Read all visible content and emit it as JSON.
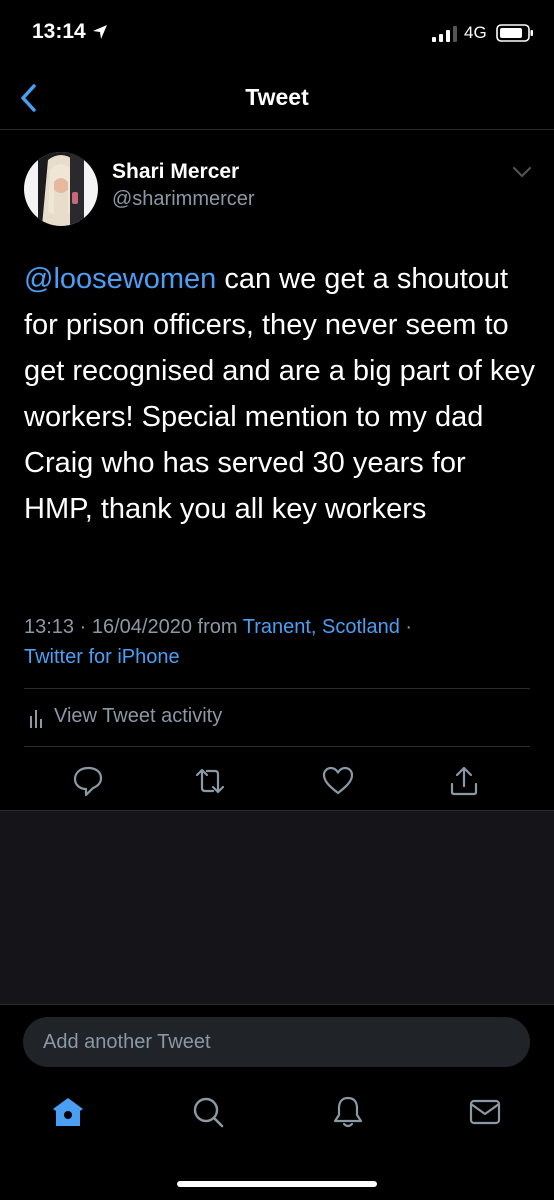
{
  "status_bar": {
    "time": "13:14",
    "network": "4G",
    "icons": [
      "location-arrow-icon",
      "signal-icon",
      "battery-icon"
    ]
  },
  "nav": {
    "title": "Tweet",
    "back_icon": "chevron-left-icon"
  },
  "tweet": {
    "author": {
      "display_name": "Shari Mercer",
      "handle": "@sharimmercer"
    },
    "mention": "@loosewomen",
    "text": " can we get a shoutout for prison officers, they never seem to get recognised and are a big part of key workers! Special mention to my dad Craig who has served 30 years for HMP, thank you all key workers",
    "meta": {
      "time": "13:13",
      "separator": " · ",
      "date": "16/04/2020",
      "from_label": " from ",
      "location": "Tranent, Scotland",
      "separator2": " · ",
      "source": "Twitter for iPhone"
    },
    "activity_label": "View Tweet activity",
    "actions": [
      "reply-icon",
      "retweet-icon",
      "like-icon",
      "share-icon"
    ]
  },
  "compose": {
    "placeholder": "Add another Tweet"
  },
  "tabs": [
    "home-icon",
    "search-icon",
    "notifications-icon",
    "messages-icon"
  ],
  "colors": {
    "accent": "#4a9ff5",
    "secondary_text": "#8b98a5",
    "background": "#000000",
    "panel": "#151519"
  }
}
